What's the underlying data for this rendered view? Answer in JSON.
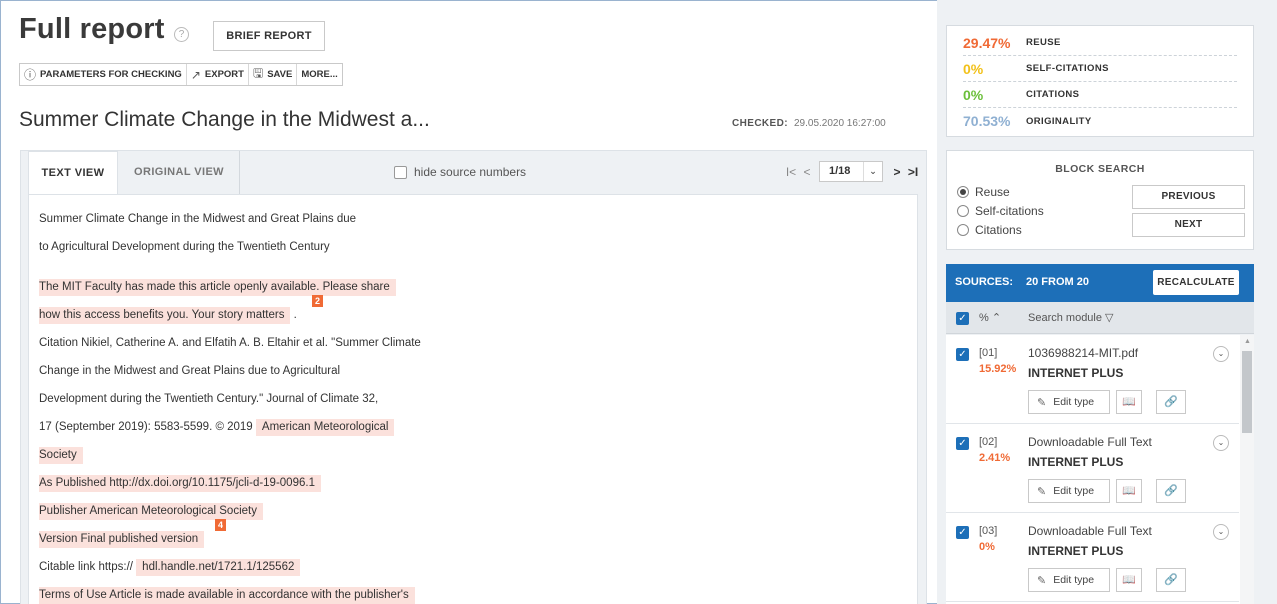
{
  "header": {
    "title": "Full report",
    "help_icon": "?",
    "brief_button": "BRIEF REPORT"
  },
  "toolbar": {
    "params_icon": "ⓘ",
    "params": "PARAMETERS FOR CHECKING",
    "export_icon": "↗",
    "export": "EXPORT",
    "save_icon": "🖫",
    "save": "SAVE",
    "more": "MORE..."
  },
  "document": {
    "title": "Summer Climate Change in the Midwest a...",
    "checked_label": "CHECKED:",
    "checked_value": "29.05.2020 16:27:00"
  },
  "viewer": {
    "tab_text": "TEXT VIEW",
    "tab_original": "ORIGINAL VIEW",
    "hide_sources": "hide source numbers",
    "page": "1/18",
    "first_icon": "I<",
    "prev_icon": "<",
    "next_icon": ">",
    "last_icon": ">I",
    "dropdown_icon": "⌄"
  },
  "text": {
    "l1": "Summer Climate Change in the Midwest and Great Plains due",
    "l2": "to Agricultural Development during the Twentieth Century",
    "l3": "The MIT Faculty has made this article openly available. Please share",
    "b2": "2",
    "l4": "how this access benefits you. Your story matters",
    "l4_tail": ".",
    "l5": "Citation Nikiel, Catherine A. and Elfatih A. B. Eltahir et al. \"Summer Climate",
    "l6": "Change in the Midwest and Great Plains due to Agricultural",
    "l7": "Development during the Twentieth Century.\" Journal of Climate 32,",
    "l8a": "17 (September 2019): 5583-5599. © 2019",
    "l8b": "American Meteorological",
    "l9": "Society",
    "l10": "As Published http://dx.doi.org/10.1175/jcli-d-19-0096.1",
    "l11": "Publisher American Meteorological Society",
    "b4": "4",
    "l12": "Version Final published version",
    "l13a": "Citable link https://",
    "l13b": "hdl.handle.net/1721.1/125562",
    "l14": "Terms of Use Article is made available in accordance with the publisher's"
  },
  "stats": [
    {
      "value": "29.47%",
      "label": "REUSE",
      "color": "#f06a35"
    },
    {
      "value": "0%",
      "label": "SELF-CITATIONS",
      "color": "#f2c11a"
    },
    {
      "value": "0%",
      "label": "CITATIONS",
      "color": "#6bbf3a"
    },
    {
      "value": "70.53%",
      "label": "ORIGINALITY",
      "color": "#8fb0d2"
    }
  ],
  "block_search": {
    "title": "BLOCK SEARCH",
    "options": [
      "Reuse",
      "Self-citations",
      "Citations"
    ],
    "previous": "PREVIOUS",
    "next": "NEXT"
  },
  "sources": {
    "label": "SOURCES:",
    "count": "20 FROM 20",
    "recalculate": "RECALCULATE",
    "col_pct": "% ⌃",
    "col_module": "Search module ▽",
    "check_mark": "✓",
    "expand_icon": "⌄",
    "edit_icon": "✎",
    "book_icon": "📖",
    "link_icon": "🔗",
    "edit_type": "Edit type",
    "scroll_up": "▲",
    "items": [
      {
        "num": "[01]",
        "percent": "15.92%",
        "name": "1036988214-MIT.pdf",
        "module": "INTERNET PLUS"
      },
      {
        "num": "[02]",
        "percent": "2.41%",
        "name": "Downloadable Full Text",
        "module": "INTERNET PLUS"
      },
      {
        "num": "[03]",
        "percent": "0%",
        "name": "Downloadable Full Text",
        "module": "INTERNET PLUS"
      }
    ]
  },
  "colors": {
    "accent": "#1d6fb8",
    "highlight": "#fbe1dc",
    "badge": "#f06a35"
  }
}
